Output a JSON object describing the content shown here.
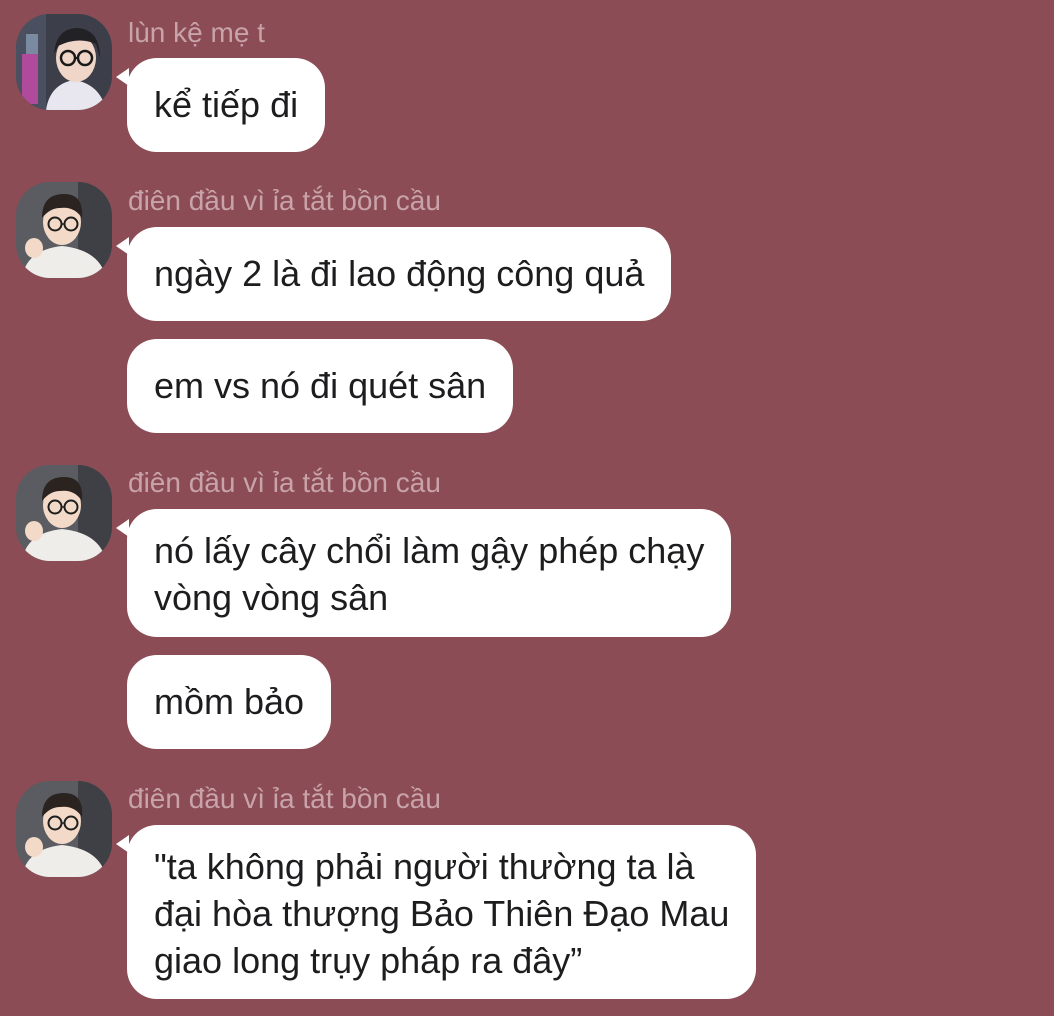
{
  "theme": {
    "background": "#8c4c55",
    "bubble": "#ffffff",
    "sender_name_color": "#c9a3aa",
    "text": "#1d1d1f"
  },
  "messages": [
    {
      "sender": "lùn kệ mẹ t",
      "avatar": "avatar-girl-glasses",
      "bubbles": [
        {
          "lines": [
            "kể tiếp đi"
          ]
        }
      ]
    },
    {
      "sender": "điên đầu vì ỉa tắt bồn cầu",
      "avatar": "avatar-boy-glasses",
      "bubbles": [
        {
          "lines": [
            "ngày 2 là đi lao động công quả"
          ]
        },
        {
          "lines": [
            "em vs nó đi quét sân"
          ]
        }
      ]
    },
    {
      "sender": "điên đầu vì ỉa tắt bồn cầu",
      "avatar": "avatar-boy-glasses",
      "bubbles": [
        {
          "lines": [
            "nó lấy cây chổi làm gậy phép chạy",
            "vòng vòng sân"
          ]
        },
        {
          "lines": [
            "mồm bảo"
          ]
        }
      ]
    },
    {
      "sender": "điên đầu vì ỉa tắt bồn cầu",
      "avatar": "avatar-boy-glasses",
      "bubbles": [
        {
          "lines": [
            "\"ta không phải người thường ta là",
            "đại hòa thượng Bảo Thiên Đạo Mau",
            "giao long trụy pháp ra đây”"
          ]
        }
      ]
    }
  ]
}
